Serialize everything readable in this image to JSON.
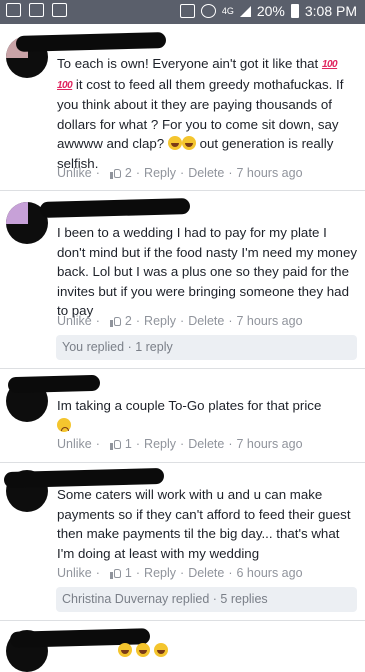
{
  "status_bar": {
    "battery": "20%",
    "time": "3:08 PM",
    "network": "4G"
  },
  "comments": [
    {
      "text": "To each is own! Everyone ain't got it like that 💯💯 it cost to feed all them greedy mothafuckas. If you think about it they are paying thousands of dollars for what ? For you to come sit down, say awwww and clap? 😂😂 out generation is really selfish.",
      "text_before_emoji1": "To each is own! Everyone ain't got it like that ",
      "text_mid": " it cost to feed all them greedy mothafuckas. If you think about it they are paying thousands of dollars for what ? For you to come sit down, say awwww and clap? ",
      "text_end": " out generation is really selfish.",
      "unlike": "Unlike",
      "likes": "2",
      "reply": "Reply",
      "delete": "Delete",
      "time": "7 hours ago"
    },
    {
      "text": "I been to a wedding I had to pay for my plate I don't mind but if the food nasty I'm need my money back. Lol but I was a plus one so they paid for the invites but if you were bringing someone they had to pay",
      "unlike": "Unlike",
      "likes": "2",
      "reply": "Reply",
      "delete": "Delete",
      "time": "7 hours ago",
      "replies_summary": "You replied · 1 reply"
    },
    {
      "text": "Im taking a couple To-Go plates for that price 😩",
      "text_plain": "Im taking a couple To-Go plates for that price",
      "unlike": "Unlike",
      "likes": "1",
      "reply": "Reply",
      "delete": "Delete",
      "time": "7 hours ago"
    },
    {
      "text": "Some caters will work with u and u can make payments so if they can't afford to feed their guest then make payments til the big day... that's what I'm doing at least with my wedding",
      "unlike": "Unlike",
      "likes": "1",
      "reply": "Reply",
      "delete": "Delete",
      "time": "6 hours ago",
      "replies_summary": "Christina Duvernay replied · 5 replies"
    }
  ],
  "separator": "·",
  "colors": {
    "status_bar": "#5a5f6b",
    "text": "#1d2129",
    "meta": "#90949c",
    "reply_box": "#eceff3"
  }
}
